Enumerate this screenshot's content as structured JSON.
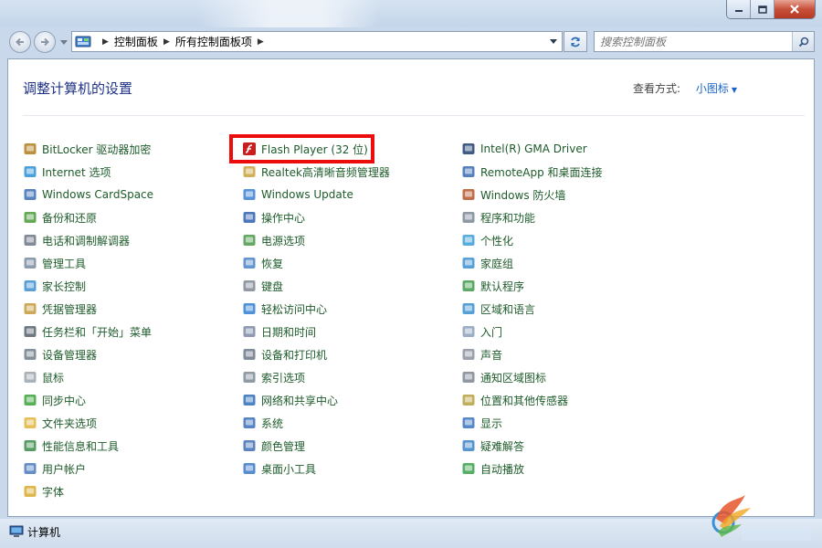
{
  "window": {
    "caption_buttons": [
      "minimize-icon",
      "maximize-icon",
      "close-icon"
    ]
  },
  "nav": {
    "back_icon": "back-arrow-icon",
    "forward_icon": "forward-arrow-icon",
    "breadcrumbs": [
      "控制面板",
      "所有控制面板项"
    ],
    "search_placeholder": "搜索控制面板"
  },
  "content": {
    "heading": "调整计算机的设置",
    "view_by_label": "查看方式:",
    "view_mode": "小图标",
    "columns": [
      [
        {
          "label": "BitLocker 驱动器加密",
          "icon": "bitlocker-key-icon"
        },
        {
          "label": "Internet 选项",
          "icon": "internet-options-icon"
        },
        {
          "label": "Windows CardSpace",
          "icon": "cardspace-icon"
        },
        {
          "label": "备份和还原",
          "icon": "backup-restore-icon"
        },
        {
          "label": "电话和调制解调器",
          "icon": "phone-modem-icon"
        },
        {
          "label": "管理工具",
          "icon": "admin-tools-icon"
        },
        {
          "label": "家长控制",
          "icon": "parental-controls-icon"
        },
        {
          "label": "凭据管理器",
          "icon": "credential-manager-icon"
        },
        {
          "label": "任务栏和「开始」菜单",
          "icon": "taskbar-start-icon"
        },
        {
          "label": "设备管理器",
          "icon": "device-manager-icon"
        },
        {
          "label": "鼠标",
          "icon": "mouse-icon"
        },
        {
          "label": "同步中心",
          "icon": "sync-center-icon"
        },
        {
          "label": "文件夹选项",
          "icon": "folder-options-icon"
        },
        {
          "label": "性能信息和工具",
          "icon": "performance-icon"
        },
        {
          "label": "用户帐户",
          "icon": "user-accounts-icon"
        },
        {
          "label": "字体",
          "icon": "fonts-icon"
        }
      ],
      [
        {
          "label": "Flash Player (32 位)",
          "icon": "flash-player-icon"
        },
        {
          "label": "Realtek高清晰音频管理器",
          "icon": "realtek-audio-icon"
        },
        {
          "label": "Windows Update",
          "icon": "windows-update-icon"
        },
        {
          "label": "操作中心",
          "icon": "action-center-flag-icon"
        },
        {
          "label": "电源选项",
          "icon": "power-options-icon"
        },
        {
          "label": "恢复",
          "icon": "recovery-icon"
        },
        {
          "label": "键盘",
          "icon": "keyboard-icon"
        },
        {
          "label": "轻松访问中心",
          "icon": "ease-of-access-icon"
        },
        {
          "label": "日期和时间",
          "icon": "date-time-icon"
        },
        {
          "label": "设备和打印机",
          "icon": "devices-printers-icon"
        },
        {
          "label": "索引选项",
          "icon": "indexing-options-icon"
        },
        {
          "label": "网络和共享中心",
          "icon": "network-sharing-icon"
        },
        {
          "label": "系统",
          "icon": "system-icon"
        },
        {
          "label": "颜色管理",
          "icon": "color-management-icon"
        },
        {
          "label": "桌面小工具",
          "icon": "desktop-gadgets-icon"
        }
      ],
      [
        {
          "label": "Intel(R) GMA Driver",
          "icon": "intel-gma-icon"
        },
        {
          "label": "RemoteApp 和桌面连接",
          "icon": "remoteapp-icon"
        },
        {
          "label": "Windows 防火墙",
          "icon": "firewall-icon"
        },
        {
          "label": "程序和功能",
          "icon": "programs-features-icon"
        },
        {
          "label": "个性化",
          "icon": "personalization-icon"
        },
        {
          "label": "家庭组",
          "icon": "homegroup-icon"
        },
        {
          "label": "默认程序",
          "icon": "default-programs-icon"
        },
        {
          "label": "区域和语言",
          "icon": "region-language-icon"
        },
        {
          "label": "入门",
          "icon": "getting-started-icon"
        },
        {
          "label": "声音",
          "icon": "sound-icon"
        },
        {
          "label": "通知区域图标",
          "icon": "notification-area-icon"
        },
        {
          "label": "位置和其他传感器",
          "icon": "location-sensors-icon"
        },
        {
          "label": "显示",
          "icon": "display-icon"
        },
        {
          "label": "疑难解答",
          "icon": "troubleshooting-icon"
        },
        {
          "label": "自动播放",
          "icon": "autoplay-icon"
        }
      ]
    ],
    "highlighted_item": "Flash Player (32 位)",
    "highlight_color": "#ec0c0c",
    "link_color": "#1e5b2b",
    "heading_color": "#1e3287"
  },
  "statusbar": {
    "text": "计算机",
    "icon": "computer-icon"
  }
}
